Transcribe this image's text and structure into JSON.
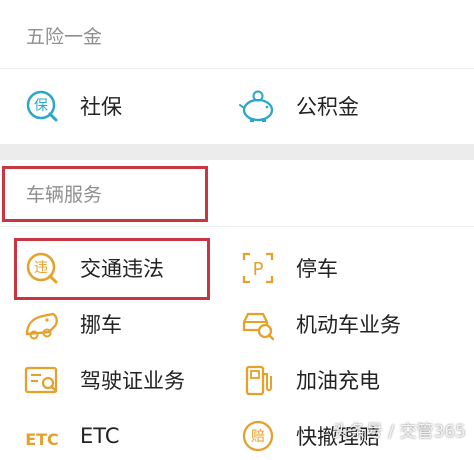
{
  "sections": {
    "insurance_title": "五险一金",
    "vehicle_title": "车辆服务"
  },
  "insurance_items": [
    {
      "label": "社保",
      "icon": "social-security-icon"
    },
    {
      "label": "公积金",
      "icon": "piggy-bank-icon"
    }
  ],
  "vehicle_items": [
    {
      "label": "交通违法",
      "icon": "traffic-violation-icon",
      "icon_text": "违"
    },
    {
      "label": "停车",
      "icon": "parking-icon",
      "icon_text": "P"
    },
    {
      "label": "挪车",
      "icon": "move-car-icon"
    },
    {
      "label": "机动车业务",
      "icon": "vehicle-search-icon"
    },
    {
      "label": "驾驶证业务",
      "icon": "driver-license-icon"
    },
    {
      "label": "加油充电",
      "icon": "fuel-pump-icon"
    },
    {
      "label": "ETC",
      "icon": "etc-icon",
      "icon_text": "ETC"
    },
    {
      "label": "快撤理赔",
      "icon": "claim-icon",
      "icon_text": "赔"
    }
  ],
  "icon_colors": {
    "insurance": "#2aa7c9",
    "vehicle": "#e6a12b"
  },
  "highlight_color": "#c8363f",
  "watermark": "头条号 / 交管365"
}
